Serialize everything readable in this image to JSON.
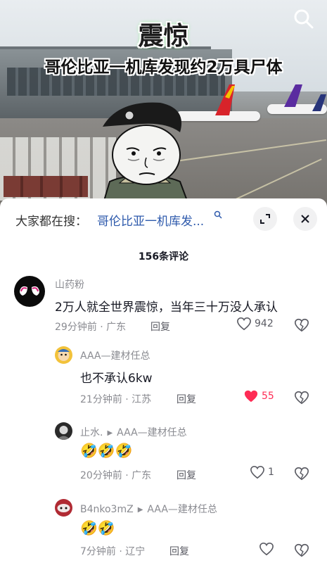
{
  "video": {
    "title_main": "震惊",
    "title_sub": "哥伦比亚一机库发现约2万具尸体",
    "search_icon": "search-icon"
  },
  "search_bar": {
    "prefix": "大家都在搜：",
    "query": "哥伦比亚一机库发...",
    "expand_icon": "expand-icon",
    "close_icon": "close-icon"
  },
  "comments_count": "156条评论",
  "comments": [
    {
      "name": "山药粉",
      "text": "2万人就全世界震惊，当年三十万没人承认",
      "time": "29分钟前 · 广东",
      "reply": "回复",
      "likes": "942",
      "liked": false
    },
    {
      "name": "AAA—建材任总",
      "text": "也不承认6kw",
      "time": "21分钟前 · 江苏",
      "reply": "回复",
      "likes": "55",
      "liked": true
    },
    {
      "name": "止水.",
      "reply_to": "AAA—建材任总",
      "text": "🤣🤣🤣",
      "time": "20分钟前 · 广东",
      "reply": "回复",
      "likes": "1",
      "liked": false
    },
    {
      "name": "B4nko3mZ",
      "reply_to": "AAA—建材任总",
      "text": "🤣🤣",
      "time": "7分钟前 · 辽宁",
      "reply": "回复",
      "likes": "",
      "liked": false
    }
  ],
  "colors": {
    "liked_heart": "#fe2c55",
    "query_link": "#2e5aac",
    "muted": "#8a8b91"
  }
}
